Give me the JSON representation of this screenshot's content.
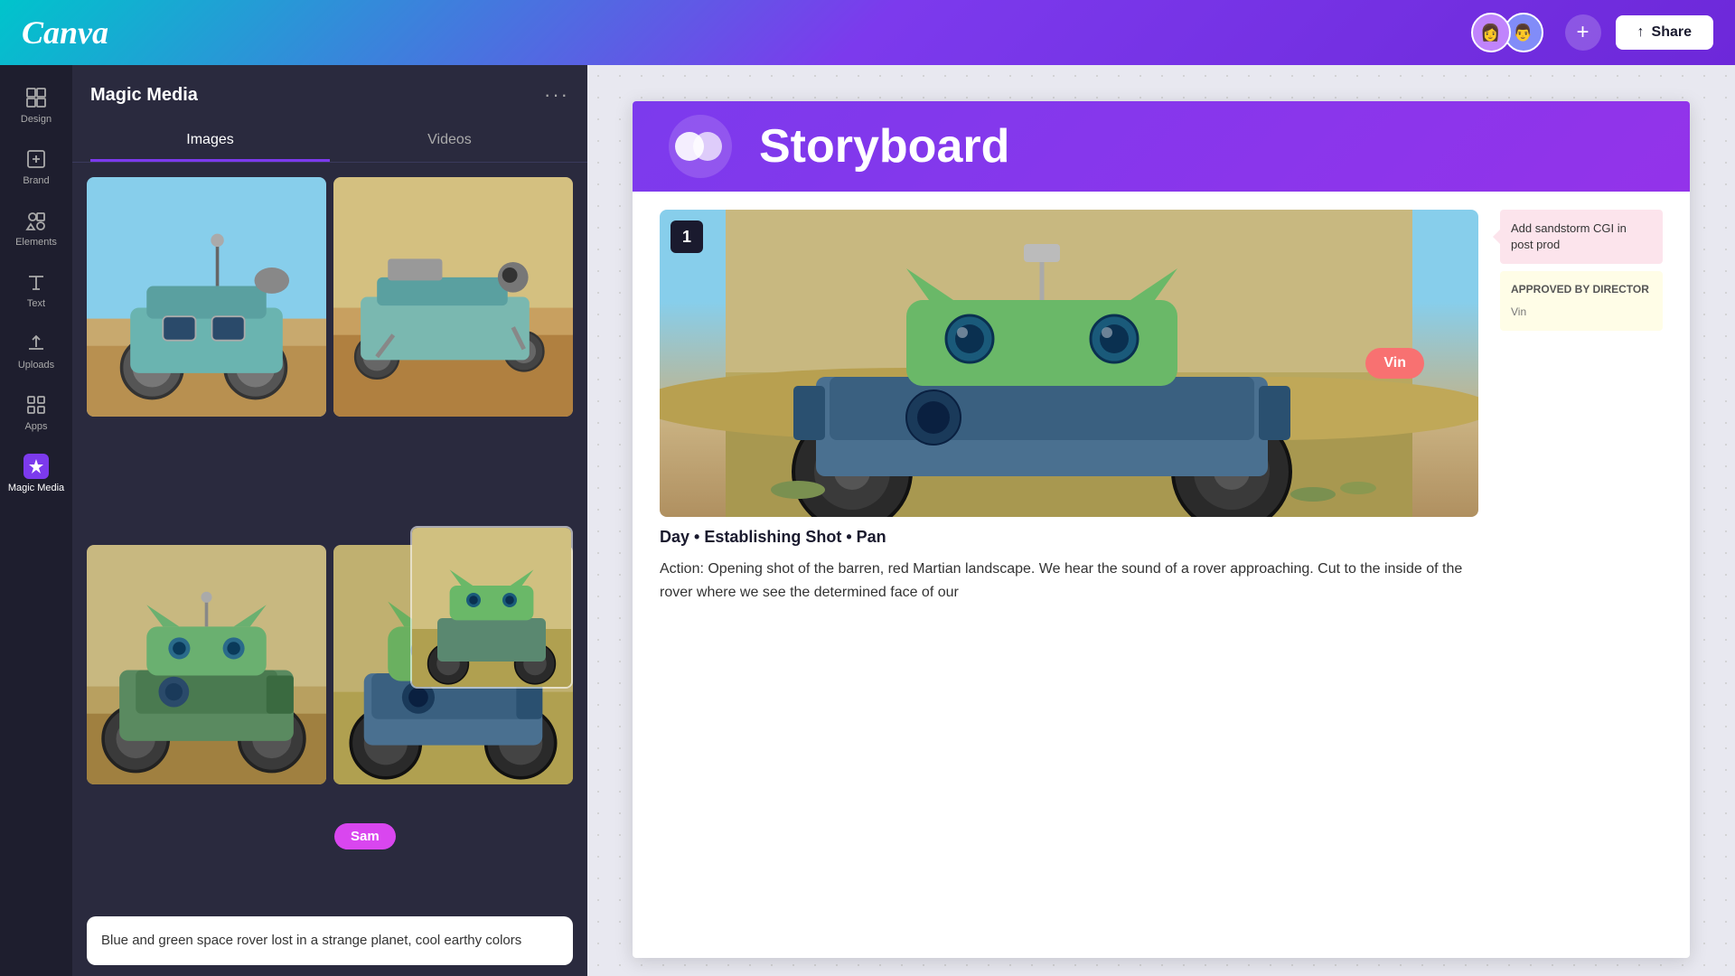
{
  "header": {
    "logo": "Canva",
    "share_label": "Share",
    "add_collaborator": "+",
    "share_icon": "↑"
  },
  "sidebar": {
    "items": [
      {
        "id": "design",
        "label": "Design",
        "icon": "design"
      },
      {
        "id": "brand",
        "label": "Brand",
        "icon": "brand"
      },
      {
        "id": "elements",
        "label": "Elements",
        "icon": "elements"
      },
      {
        "id": "text",
        "label": "Text",
        "icon": "text"
      },
      {
        "id": "uploads",
        "label": "Uploads",
        "icon": "uploads"
      },
      {
        "id": "apps",
        "label": "Apps",
        "icon": "apps"
      },
      {
        "id": "magic-media",
        "label": "Magic Media",
        "icon": "magic"
      }
    ]
  },
  "panel": {
    "title": "Magic Media",
    "menu_dots": "···",
    "tabs": [
      {
        "id": "images",
        "label": "Images",
        "active": true
      },
      {
        "id": "videos",
        "label": "Videos",
        "active": false
      }
    ],
    "prompt_placeholder": "Blue and green space rover lost in a strange planet, cool earthy colors"
  },
  "canvas": {
    "storyboard": {
      "logo_alt": "Canva logo circles",
      "title": "Storyboard",
      "scene": {
        "number": "1",
        "caption": "Day • Establishing Shot • Pan",
        "description": "Action: Opening shot of the barren, red Martian landscape. We hear the sound of a rover approaching. Cut to the inside of the rover where we see the determined face of our"
      }
    },
    "annotations": [
      {
        "id": "sandstorm",
        "text": "Add sandstorm CGI in post prod"
      },
      {
        "id": "approved",
        "label": "APPROVED BY DIRECTOR",
        "author": "Vin"
      }
    ],
    "vin_badge": "Vin",
    "sam_badge": "Sam"
  }
}
